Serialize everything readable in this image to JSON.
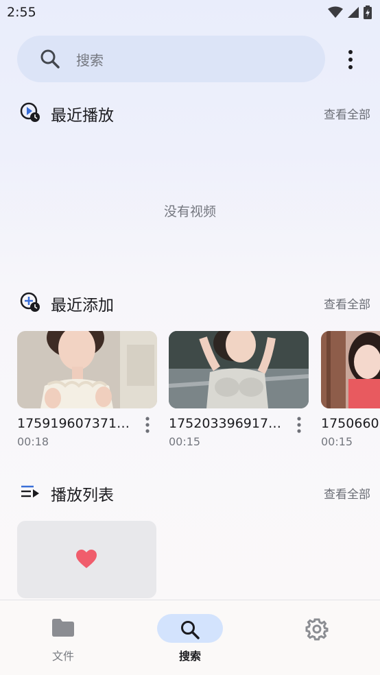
{
  "status_bar": {
    "time": "2:55"
  },
  "search": {
    "placeholder": "搜索"
  },
  "recent_played": {
    "title": "最近播放",
    "view_all": "查看全部",
    "empty_text": "没有视频"
  },
  "recent_added": {
    "title": "最近添加",
    "view_all": "查看全部",
    "videos": [
      {
        "title": "175919607371…",
        "duration": "00:18"
      },
      {
        "title": "175203396917…",
        "duration": "00:15"
      },
      {
        "title": "1750660",
        "duration": "00:15"
      }
    ]
  },
  "playlists": {
    "title": "播放列表",
    "view_all": "查看全部"
  },
  "bottom_nav": {
    "files": "文件",
    "search": "搜索",
    "settings": ""
  },
  "colors": {
    "accent": "#d3e3fd",
    "heart": "#f05d6c"
  }
}
